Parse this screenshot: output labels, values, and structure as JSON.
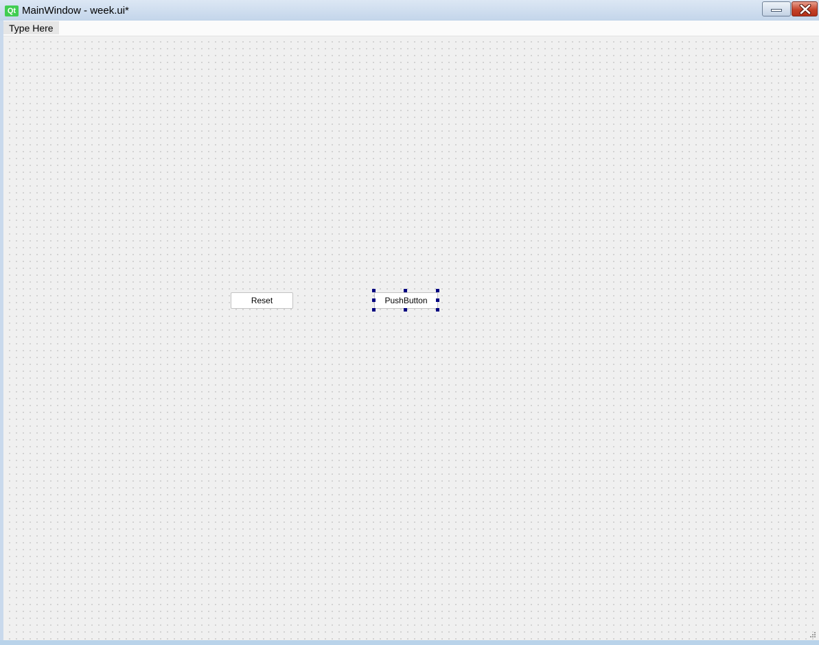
{
  "window": {
    "title": "MainWindow - week.ui*",
    "logo_text": "Qt",
    "logo_color": "#41cd52"
  },
  "menubar": {
    "items": [
      {
        "label": "Type Here"
      }
    ]
  },
  "form": {
    "buttons": [
      {
        "label": "Reset",
        "selected": false
      },
      {
        "label": "PushButton",
        "selected": true
      }
    ],
    "selection_handle_color": "#000080",
    "grid": true
  },
  "controls": {
    "minimize_icon": "minimize-icon",
    "close_icon": "close-icon"
  }
}
